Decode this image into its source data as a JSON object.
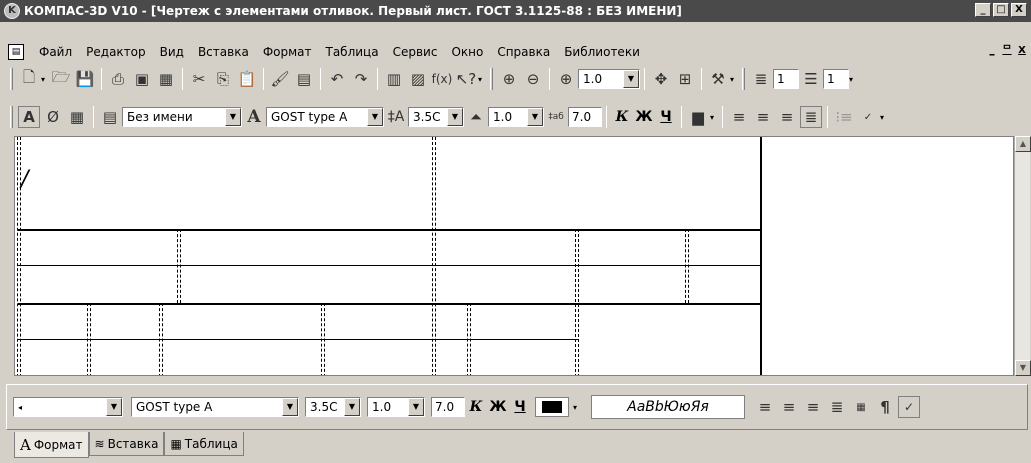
{
  "window": {
    "title": "КОМПАС-3D V10 - [Чертеж с элементами отливок. Первый лист. ГОСТ 3.1125-88 : БЕЗ ИМЕНИ]",
    "controls": [
      "_",
      "□",
      "X"
    ]
  },
  "menu": {
    "items": [
      "Файл",
      "Редактор",
      "Вид",
      "Вставка",
      "Формат",
      "Таблица",
      "Сервис",
      "Окно",
      "Справка",
      "Библиотеки"
    ],
    "mdi_controls": [
      "_",
      "ᄆ",
      "X"
    ]
  },
  "toolbar1": {
    "zoom_value": "1.0",
    "step_value1": "1",
    "step_value2": "1"
  },
  "toolbar2": {
    "style_name": "Без имени",
    "font_name": "GOST type A",
    "font_size": "3.5C",
    "line_spacing": "1.0",
    "char_step": "7.0",
    "italic_label": "К",
    "bold_label": "Ж",
    "underline_label": "Ч"
  },
  "bottom_panel": {
    "font_name": "GOST type A",
    "font_size": "3.5C",
    "narrowing": "1.0",
    "step": "7.0",
    "italic_label": "К",
    "bold_label": "Ж",
    "underline_label": "Ч",
    "sample_text": "АаBbЮюЯя",
    "color": "#000000"
  },
  "tabs": [
    {
      "label": "Формат",
      "icon": "A"
    },
    {
      "label": "Вставка",
      "icon": "≋"
    },
    {
      "label": "Таблица",
      "icon": "▦"
    }
  ],
  "canvas": {
    "cursor_glyph": "/"
  }
}
